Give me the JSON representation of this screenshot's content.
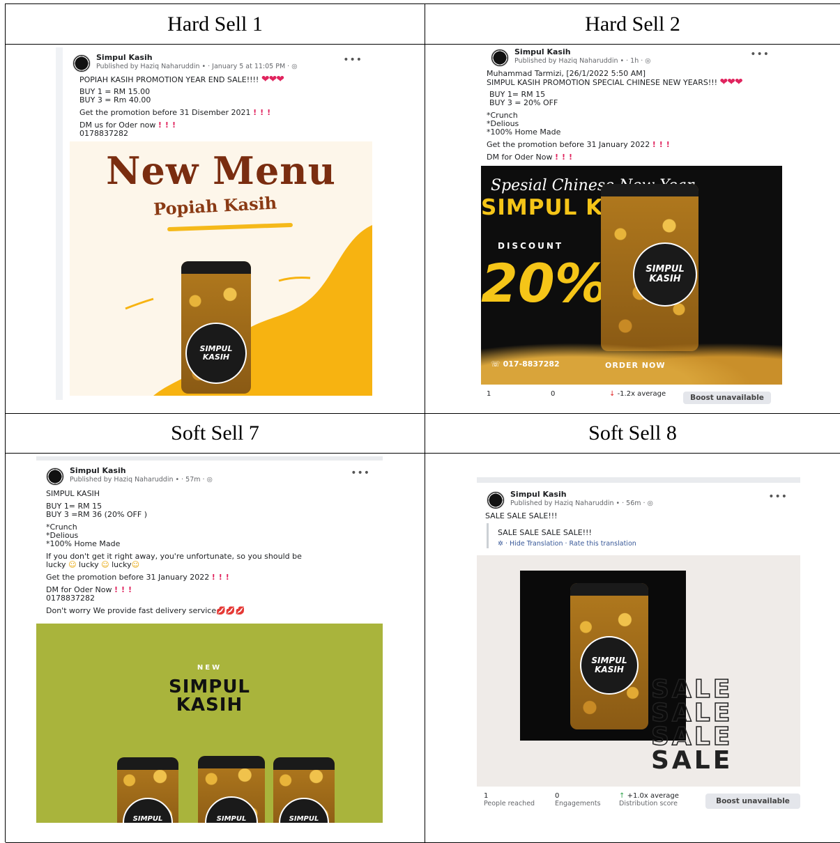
{
  "headers": {
    "hs1": "Hard Sell 1",
    "hs2": "Hard Sell 2",
    "ss7": "Soft Sell 7",
    "ss8": "Soft Sell 8"
  },
  "hs1": {
    "page_name": "Simpul Kasih",
    "published": "Published by Haziq Naharuddin • · January 5 at 11:05 PM · ◎",
    "line1": "POPIAH KASIH PROMOTION YEAR END SALE!!!!",
    "line2": "BUY 1 = RM 15.00",
    "line3": "BUY 3 = Rm 40.00",
    "line4": "Get the promotion before 31 Disember 2021",
    "line5": "DM us for Oder now",
    "line6": "0178837282",
    "image_title": "New Menu",
    "image_subtitle": "Popiah Kasih",
    "jar_label": "SIMPUL KASIH"
  },
  "hs2": {
    "page_name": "Simpul Kasih",
    "published": "Published by Haziq Naharuddin • · 1h · ◎",
    "line1": "Muhammad Tarmizi, [26/1/2022 5:50 AM]",
    "line2": "SIMPUL KASIH PROMOTION SPECIAL CHINESE NEW YEARS!!!",
    "line3": "BUY 1= RM 15",
    "line4": "BUY 3 = 20% OFF",
    "line5": "*Crunch",
    "line6": "*Delious",
    "line7": "*100% Home Made",
    "line8": "Get the promotion before 31 January 2022",
    "line9": "DM for Oder  Now",
    "image_script": "Spesial Chinese New Year",
    "image_brand": "SIMPUL KASIH",
    "image_discount_label": "DISCOUNT",
    "image_discount": "20%",
    "image_phone": "017-8837282",
    "image_order": "ORDER NOW",
    "jar_label": "SIMPUL KASIH",
    "stat1_value": "1",
    "stat2_value": "0",
    "stat3_value": "-1.2x average",
    "boost": "Boost unavailable"
  },
  "ss7": {
    "page_name": "Simpul Kasih",
    "published": "Published by Haziq Naharuddin • · 57m · ◎",
    "line1": "SIMPUL KASIH",
    "line2": " BUY 1= RM 15",
    "line3": " BUY 3 =RM 36 (20% OFF )",
    "line4": "*Crunch",
    "line5": "*Delious",
    "line6": "*100% Home Made",
    "line7": "If you don't get it right away, you're unfortunate, so you should be",
    "line8a": "lucky",
    "line8b": "lucky",
    "line8c": "lucky",
    "line9": "Get the promotion before 31 January 2022",
    "line10": "DM for Oder  Now",
    "line11": " 0178837282",
    "line12": "Don't worry We provide fast delivery service",
    "image_new": "NEW",
    "image_brand1": "SIMPUL",
    "image_brand2": "KASIH",
    "jar_label": "SIMPUL KASIH"
  },
  "ss8": {
    "page_name": "Simpul Kasih",
    "published": "Published by Haziq Naharuddin • · 56m · ◎",
    "line1": "SALE SALE SALE!!!",
    "line2": "SALE SALE SALE SALE!!!",
    "translation": "· Hide Translation · Rate this translation",
    "sale_word": "SALE",
    "jar_label": "SIMPUL KASIH",
    "stat1_value": "1",
    "stat1_label": "People reached",
    "stat2_value": "0",
    "stat2_label": "Engagements",
    "stat3_value": "+1.0x average",
    "stat3_label": "Distribution score",
    "boost": "Boost unavailable"
  }
}
